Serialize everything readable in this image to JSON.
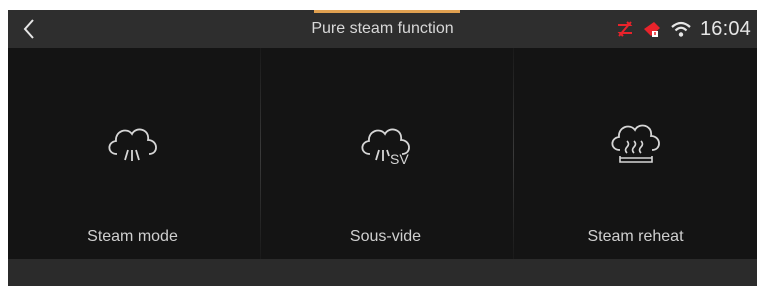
{
  "header": {
    "title": "Pure steam function",
    "back_icon": "chevron-left-icon",
    "accent_color": "#e0a050"
  },
  "status_bar": {
    "time": "16:04",
    "icons": [
      "connection-error-icon",
      "alert-icon",
      "wifi-icon"
    ],
    "alert_color": "#e8232b"
  },
  "modes": [
    {
      "label": "Steam mode",
      "icon": "steam-cloud-icon"
    },
    {
      "label": "Sous-vide",
      "icon": "sous-vide-steam-icon",
      "badge": "SV"
    },
    {
      "label": "Steam reheat",
      "icon": "steam-reheat-icon"
    }
  ]
}
